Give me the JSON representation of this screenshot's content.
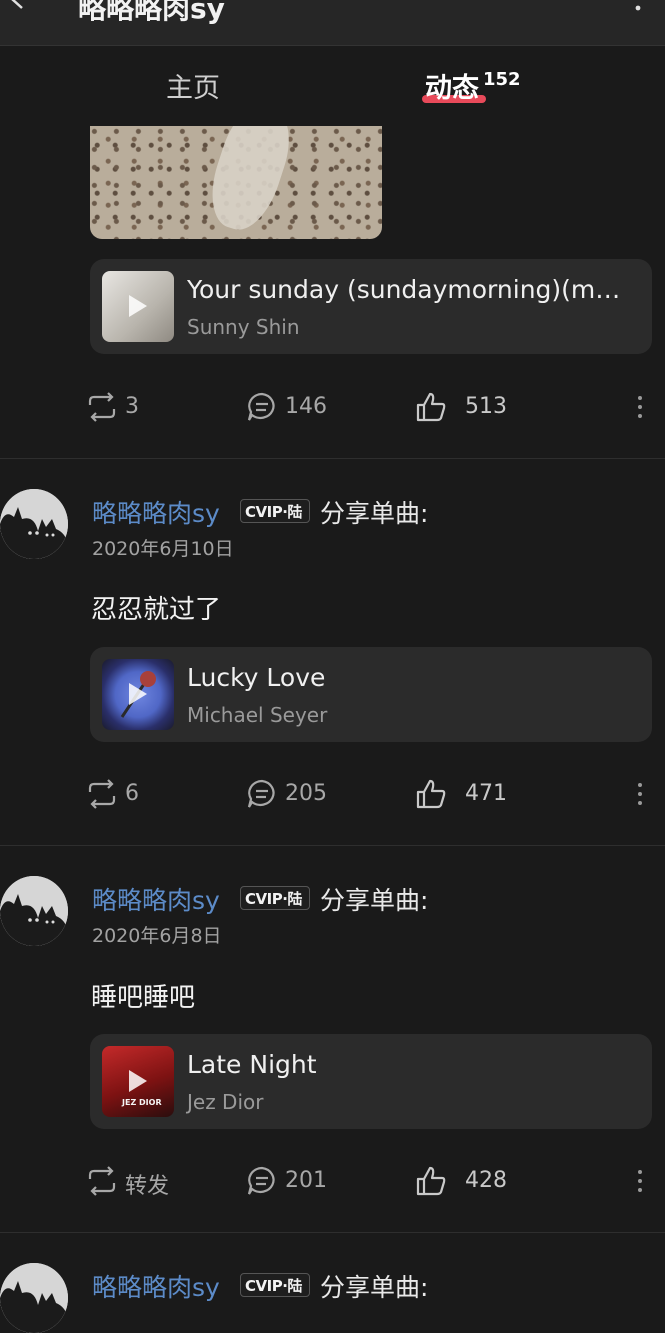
{
  "header": {
    "title": "略略略肉sy",
    "back_icon": "chevron-left-icon",
    "more_icon": "more-vertical-icon"
  },
  "tabs": [
    {
      "label": "主页"
    },
    {
      "label": "动态",
      "count": "152",
      "active": true
    }
  ],
  "accent_color": "#e84a5a",
  "link_color": "#5c8bc8",
  "first_post": {
    "song": {
      "title": "Your sunday (sundaymorning)(m…",
      "artist": "Sunny Shin"
    },
    "stats": {
      "repost": "3",
      "comments": "146",
      "likes": "513"
    }
  },
  "posts": [
    {
      "username": "略略略肉sy",
      "vip_badge": "CVIP·陆",
      "action": "分享单曲:",
      "date": "2020年6月10日",
      "text": "忍忍就过了",
      "song": {
        "title": "Lucky Love",
        "artist": "Michael Seyer"
      },
      "stats": {
        "repost": "6",
        "comments": "205",
        "likes": "471"
      }
    },
    {
      "username": "略略略肉sy",
      "vip_badge": "CVIP·陆",
      "action": "分享单曲:",
      "date": "2020年6月8日",
      "text": "睡吧睡吧",
      "song": {
        "title": "Late Night",
        "artist": "Jez Dior",
        "cover_text": "JEZ DIOR"
      },
      "stats": {
        "repost": "转发",
        "comments": "201",
        "likes": "428"
      }
    },
    {
      "username": "略略略肉sy",
      "vip_badge": "CVIP·陆",
      "action": "分享单曲:"
    }
  ]
}
